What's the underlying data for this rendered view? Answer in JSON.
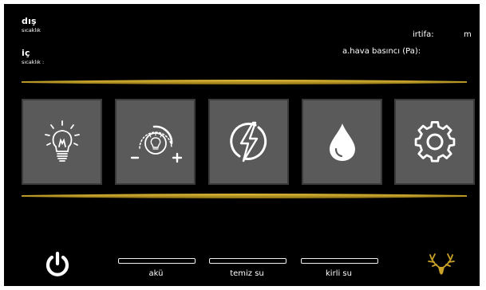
{
  "header": {
    "outdoor_title": "dış",
    "outdoor_sub": "sıcaklık",
    "indoor_title": "iç",
    "indoor_sub": "sıcaklık :",
    "altitude_label": "irtifa:",
    "altitude_unit": "m",
    "pressure_label": "a.hava basıncı (Pa):"
  },
  "tiles": [
    {
      "icon": "lightbulb-icon"
    },
    {
      "icon": "dimmer-icon"
    },
    {
      "icon": "power-bolt-icon"
    },
    {
      "icon": "water-drop-icon"
    },
    {
      "icon": "gear-icon"
    }
  ],
  "footer": {
    "power_icon": "power-icon",
    "battery_label": "akü",
    "clean_water_label": "temiz su",
    "gray_water_label": "kirli su",
    "logo_icon": "deer-antlers-logo"
  },
  "colors": {
    "background": "#000000",
    "accent_gold": "#c9a227",
    "tile": "#5a5a5a",
    "icon": "#ffffff"
  }
}
